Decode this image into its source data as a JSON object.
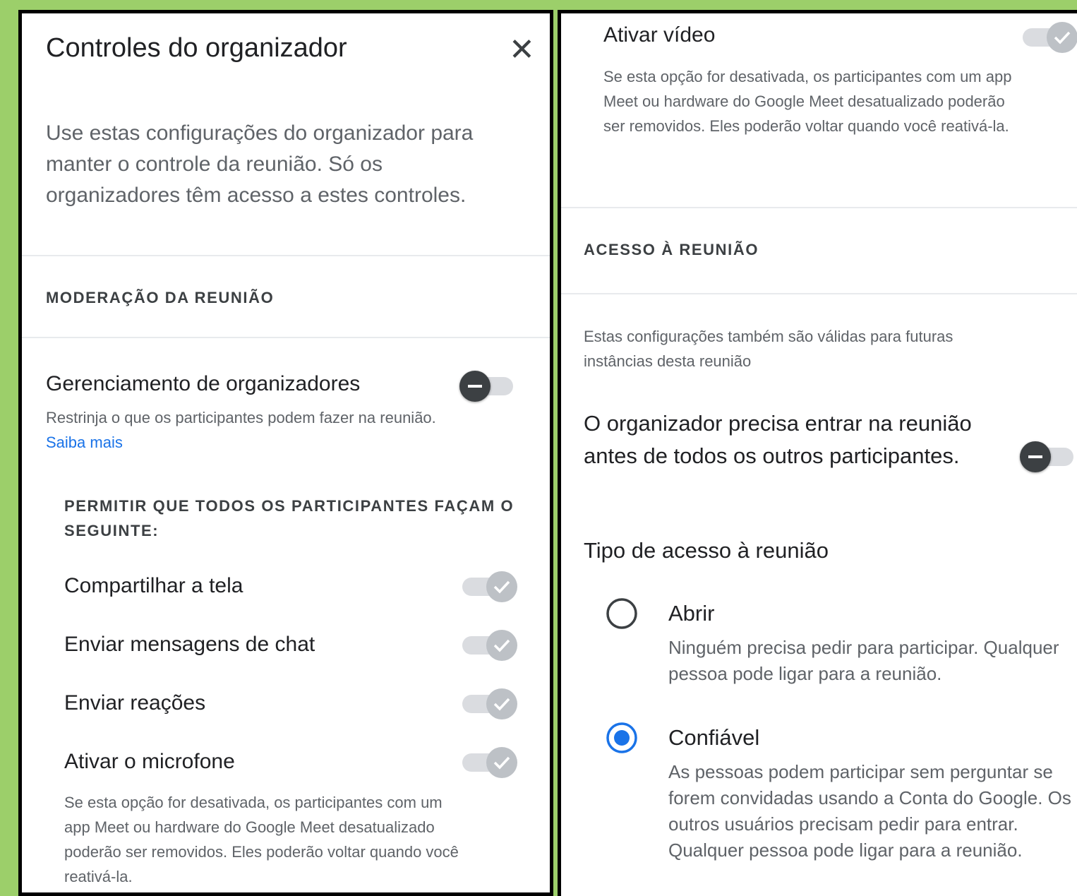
{
  "left": {
    "title": "Controles do organizador",
    "intro": "Use estas configurações do organizador para manter o controle da reunião. Só os organizadores têm acesso a estes controles.",
    "section": "MODERAÇÃO DA REUNIÃO",
    "host_management": {
      "title": "Gerenciamento de organizadores",
      "desc": "Restrinja o que os participantes podem fazer na reunião.",
      "link": "Saiba mais",
      "enabled": false
    },
    "allow_heading": "PERMITIR QUE TODOS OS PARTICIPANTES FAÇAM O SEGUINTE:",
    "toggles": [
      {
        "label": "Compartilhar a tela",
        "enabled": true
      },
      {
        "label": "Enviar mensagens de chat",
        "enabled": true
      },
      {
        "label": "Enviar reações",
        "enabled": true
      },
      {
        "label": "Ativar o microfone",
        "enabled": true
      }
    ],
    "mic_desc": "Se esta opção for desativada, os participantes com um app Meet ou hardware do Google Meet desatualizado poderão ser removidos. Eles poderão voltar quando você reativá-la."
  },
  "right": {
    "video_label": "Ativar vídeo",
    "video_enabled": true,
    "video_desc": "Se esta opção for desativada, os participantes com um app Meet ou hardware do Google Meet desatualizado poderão ser removidos. Eles poderão voltar quando você reativá-la.",
    "section": "ACESSO À REUNIÃO",
    "note": "Estas configurações também são válidas para futuras instâncias desta reunião",
    "host_first": {
      "label": "O organizador precisa entrar na reunião antes de todos os outros participantes.",
      "enabled": false
    },
    "access_type_heading": "Tipo de acesso à reunião",
    "options": [
      {
        "label": "Abrir",
        "desc": "Ninguém precisa pedir para participar. Qualquer pessoa pode ligar para a reunião.",
        "selected": false
      },
      {
        "label": "Confiável",
        "desc": "As pessoas podem participar sem perguntar se forem convidadas usando a Conta do Google. Os outros usuários precisam pedir para entrar. Qualquer pessoa pode ligar para a reunião.",
        "selected": true
      }
    ]
  },
  "colors": {
    "accent": "#1a73e8",
    "background": "#9ccf6a"
  }
}
